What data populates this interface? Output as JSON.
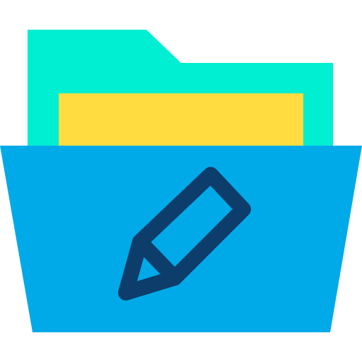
{
  "icon": {
    "name": "edit-folder-icon",
    "colors": {
      "folder_back": "#00EED2",
      "paper": "#FFDC40",
      "folder_front": "#00AAE8",
      "pencil_stroke": "#0C3D6B",
      "background": "#FFFFFF"
    }
  }
}
